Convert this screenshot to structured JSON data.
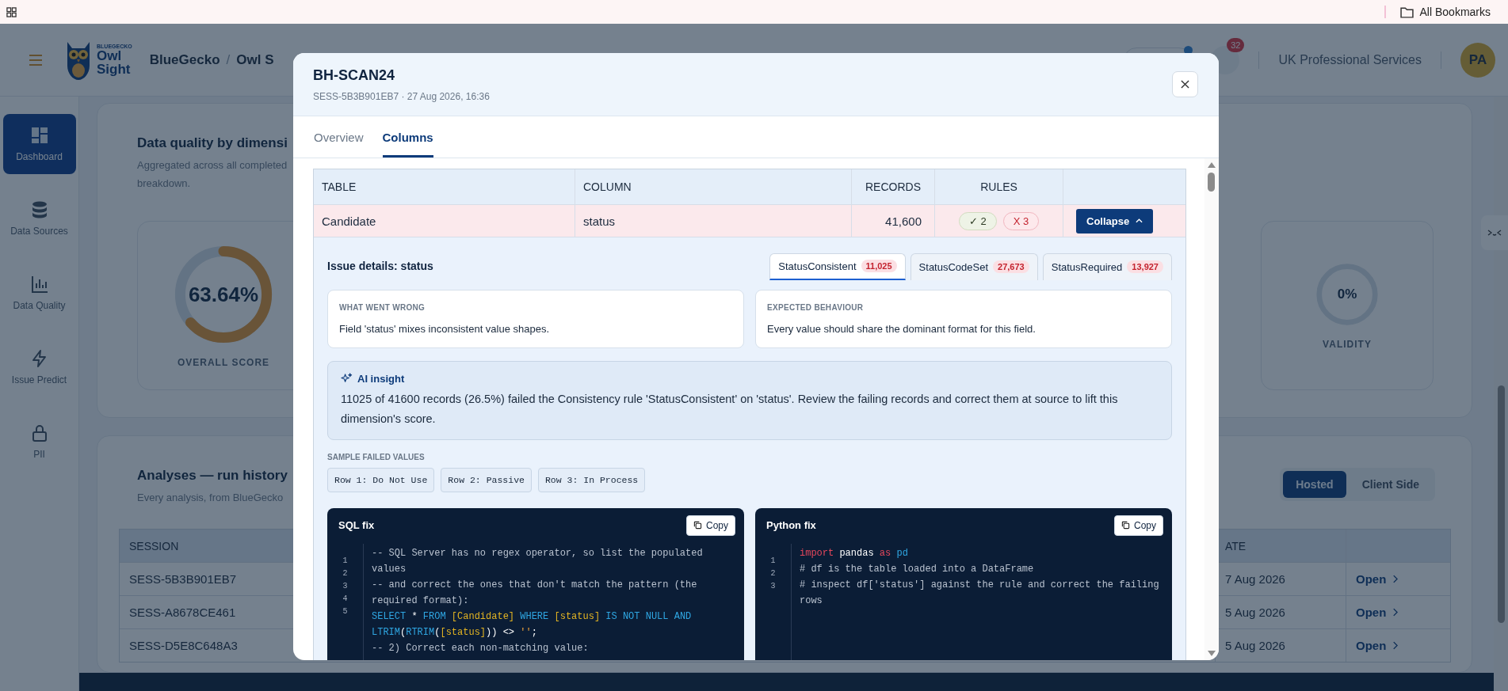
{
  "browser_bar": {
    "bookmarks": "All Bookmarks"
  },
  "header": {
    "logo_brand": "BLUEGECKO",
    "logo_lines": [
      "Owl",
      "Sight"
    ],
    "breadcrumb": [
      "BlueGecko",
      "Owl S"
    ],
    "separator": "/",
    "notifications": "32",
    "org": "UK Professional Services",
    "avatar": "PA"
  },
  "sidebar": {
    "items": [
      {
        "label": "Dashboard",
        "selected": true
      },
      {
        "label": "Data Sources",
        "selected": false
      },
      {
        "label": "Data Quality",
        "selected": false
      },
      {
        "label": "Issue Predict",
        "selected": false
      },
      {
        "label": "PII",
        "selected": false
      }
    ]
  },
  "quality": {
    "title": "Data quality by dimensi",
    "subtitle_lines": [
      "Aggregated across all completed",
      "breakdown."
    ],
    "scores": [
      {
        "kind": "overall",
        "value": "63.64%",
        "label": "OVERALL SCORE",
        "level": 0.6364
      },
      {
        "kind": "dimension",
        "value": "0%",
        "label": "VALIDITY",
        "level": 0
      }
    ]
  },
  "history": {
    "title": "Analyses — run history",
    "subtitle": "Every analysis, from BlueGecko",
    "modes": [
      {
        "label": "Hosted",
        "selected": true
      },
      {
        "label": "Client Side",
        "selected": false
      }
    ],
    "columns": [
      "SESSION",
      "ATE"
    ],
    "rows": [
      {
        "session": "SESS-5B3B901EB7",
        "date": "7 Aug 2026",
        "action": "Open"
      },
      {
        "session": "SESS-A8678CE461",
        "date": "5 Aug 2026",
        "action": "Open"
      },
      {
        "session": "SESS-D5E8C648A3",
        "date": "5 Aug 2026",
        "action": "Open"
      }
    ]
  },
  "modal": {
    "title": "BH-SCAN24",
    "subtitle": "SESS-5B3B901EB7 · 27 Aug 2026, 16:36",
    "tabs": [
      {
        "label": "Overview",
        "selected": false
      },
      {
        "label": "Columns",
        "selected": true
      }
    ],
    "table": {
      "columns": [
        "TABLE",
        "COLUMN",
        "RECORDS",
        "RULES"
      ],
      "rows": [
        {
          "table": "Candidate",
          "column": "status",
          "records": "41,600",
          "passed": "✓ 2",
          "failed": "X 3",
          "action": "Collapse",
          "expanded": true
        }
      ]
    },
    "details": {
      "title": "Issue details: status",
      "rules": [
        {
          "name": "StatusConsistent",
          "count": "11,025",
          "selected": true
        },
        {
          "name": "StatusCodeSet",
          "count": "27,673",
          "selected": false
        },
        {
          "name": "StatusRequired",
          "count": "13,927",
          "selected": false
        }
      ],
      "what_label": "WHAT WENT WRONG",
      "what": "Field 'status' mixes inconsistent value shapes.",
      "expected_label": "EXPECTED BEHAVIOUR",
      "expected": "Every value should share the dominant format for this field.",
      "insight_title": "AI insight",
      "insight": "11025 of 41600 records (26.5%) failed the Consistency rule 'StatusConsistent' on 'status'. Review the failing records and correct them at source to lift this dimension's score.",
      "samples_label": "SAMPLE FAILED VALUES",
      "samples": [
        "Row 1: Do Not Use",
        "Row 2: Passive",
        "Row 3: In Process"
      ],
      "fixes": [
        {
          "title": "SQL fix",
          "copy": "Copy",
          "line_numbers": [
            "1",
            "2",
            "3",
            "4",
            "5"
          ],
          "lines": [
            [
              {
                "kind": "comment",
                "t": "-- SQL Server has no regex operator, so list the populated values"
              }
            ],
            [
              {
                "kind": "comment",
                "t": "-- and correct the ones that don't match the pattern (the required format):"
              }
            ],
            [
              {
                "kind": "keyword",
                "t": "SELECT"
              },
              {
                "kind": "plain",
                "t": " * "
              },
              {
                "kind": "keyword",
                "t": "FROM"
              },
              {
                "kind": "ident",
                "t": " [Candidate] "
              },
              {
                "kind": "keyword",
                "t": "WHERE"
              },
              {
                "kind": "ident",
                "t": " [status] "
              },
              {
                "kind": "keyword",
                "t": "IS NOT NULL AND LTRIM"
              },
              {
                "kind": "plain",
                "t": "("
              },
              {
                "kind": "keyword",
                "t": "RTRIM"
              },
              {
                "kind": "plain",
                "t": "("
              },
              {
                "kind": "ident",
                "t": "[status]"
              },
              {
                "kind": "plain",
                "t": ")) <> "
              },
              {
                "kind": "string",
                "t": "''"
              },
              {
                "kind": "plain",
                "t": ";"
              }
            ],
            [
              {
                "kind": "comment",
                "t": "-- 2) Correct each non-matching value:"
              }
            ]
          ]
        },
        {
          "title": "Python fix",
          "copy": "Copy",
          "line_numbers": [
            "1",
            "2",
            "3"
          ],
          "lines": [
            [
              {
                "kind": "import",
                "t": "import"
              },
              {
                "kind": "plain",
                "t": " pandas "
              },
              {
                "kind": "import",
                "t": "as"
              },
              {
                "kind": "keyword",
                "t": " pd"
              }
            ],
            [
              {
                "kind": "comment",
                "t": "# df is the table loaded into a DataFrame"
              }
            ],
            [
              {
                "kind": "comment",
                "t": "# inspect df['status'] against the rule and correct the failing rows"
              }
            ]
          ]
        }
      ]
    }
  }
}
